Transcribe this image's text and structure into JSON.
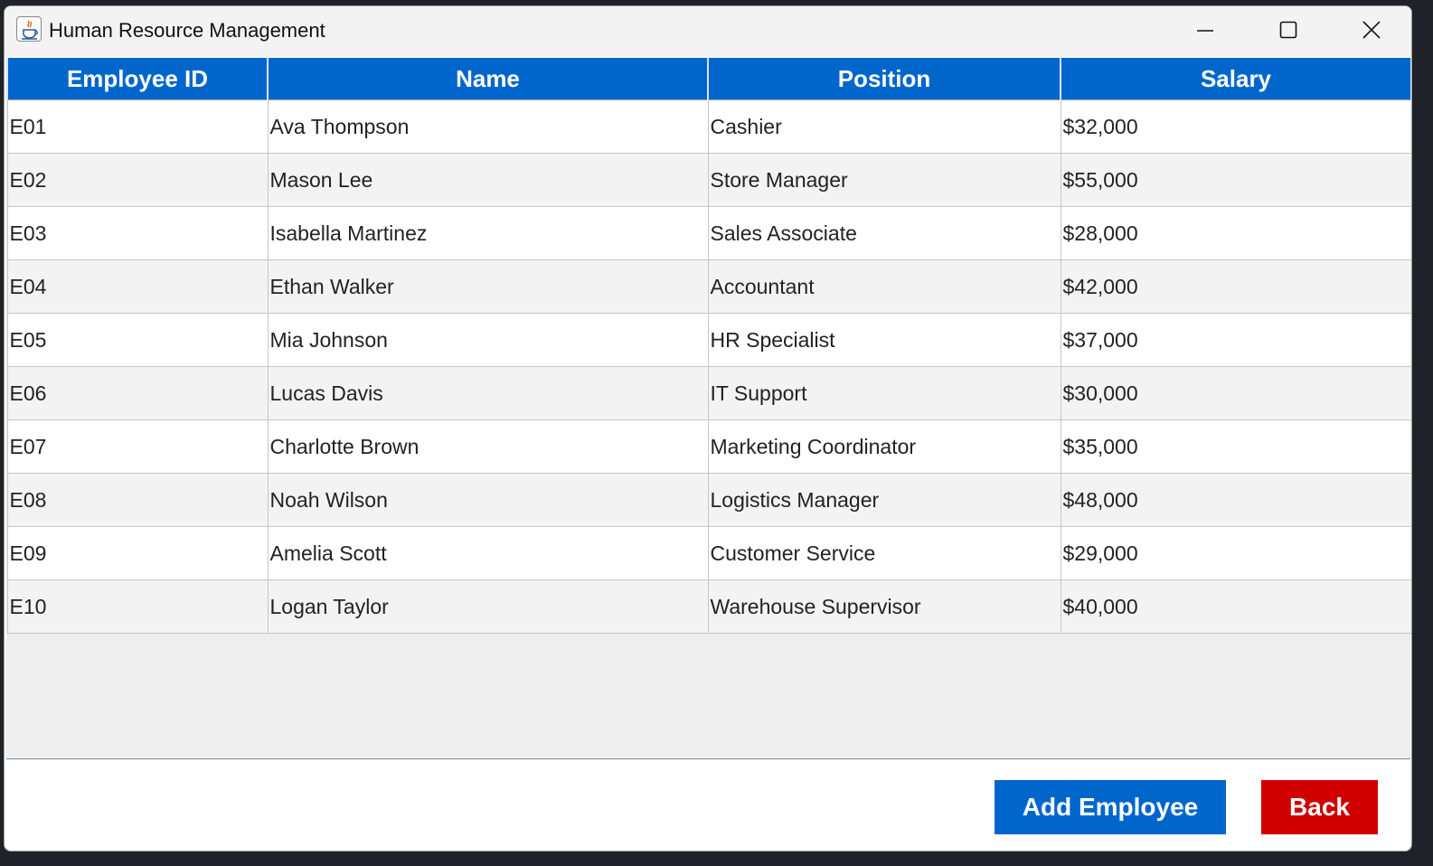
{
  "window": {
    "title": "Human Resource Management",
    "icon": "java-cup-icon"
  },
  "titlebar_controls": [
    "minimize-icon",
    "maximize-icon",
    "close-icon"
  ],
  "table": {
    "columns": [
      "Employee ID",
      "Name",
      "Position",
      "Salary"
    ],
    "rows": [
      [
        "E01",
        "Ava Thompson",
        "Cashier",
        "$32,000"
      ],
      [
        "E02",
        "Mason Lee",
        "Store Manager",
        "$55,000"
      ],
      [
        "E03",
        "Isabella Martinez",
        "Sales Associate",
        "$28,000"
      ],
      [
        "E04",
        "Ethan Walker",
        "Accountant",
        "$42,000"
      ],
      [
        "E05",
        "Mia Johnson",
        "HR Specialist",
        "$37,000"
      ],
      [
        "E06",
        "Lucas Davis",
        "IT Support",
        "$30,000"
      ],
      [
        "E07",
        "Charlotte Brown",
        "Marketing Coordinator",
        "$35,000"
      ],
      [
        "E08",
        "Noah Wilson",
        "Logistics Manager",
        "$48,000"
      ],
      [
        "E09",
        "Amelia Scott",
        "Customer Service",
        "$29,000"
      ],
      [
        "E10",
        "Logan Taylor",
        "Warehouse Supervisor",
        "$40,000"
      ]
    ]
  },
  "buttons": {
    "add_label": "Add Employee",
    "back_label": "Back"
  },
  "colors": {
    "header_bg": "#0066cc",
    "add_button": "#0066cc",
    "back_button": "#d00000"
  }
}
